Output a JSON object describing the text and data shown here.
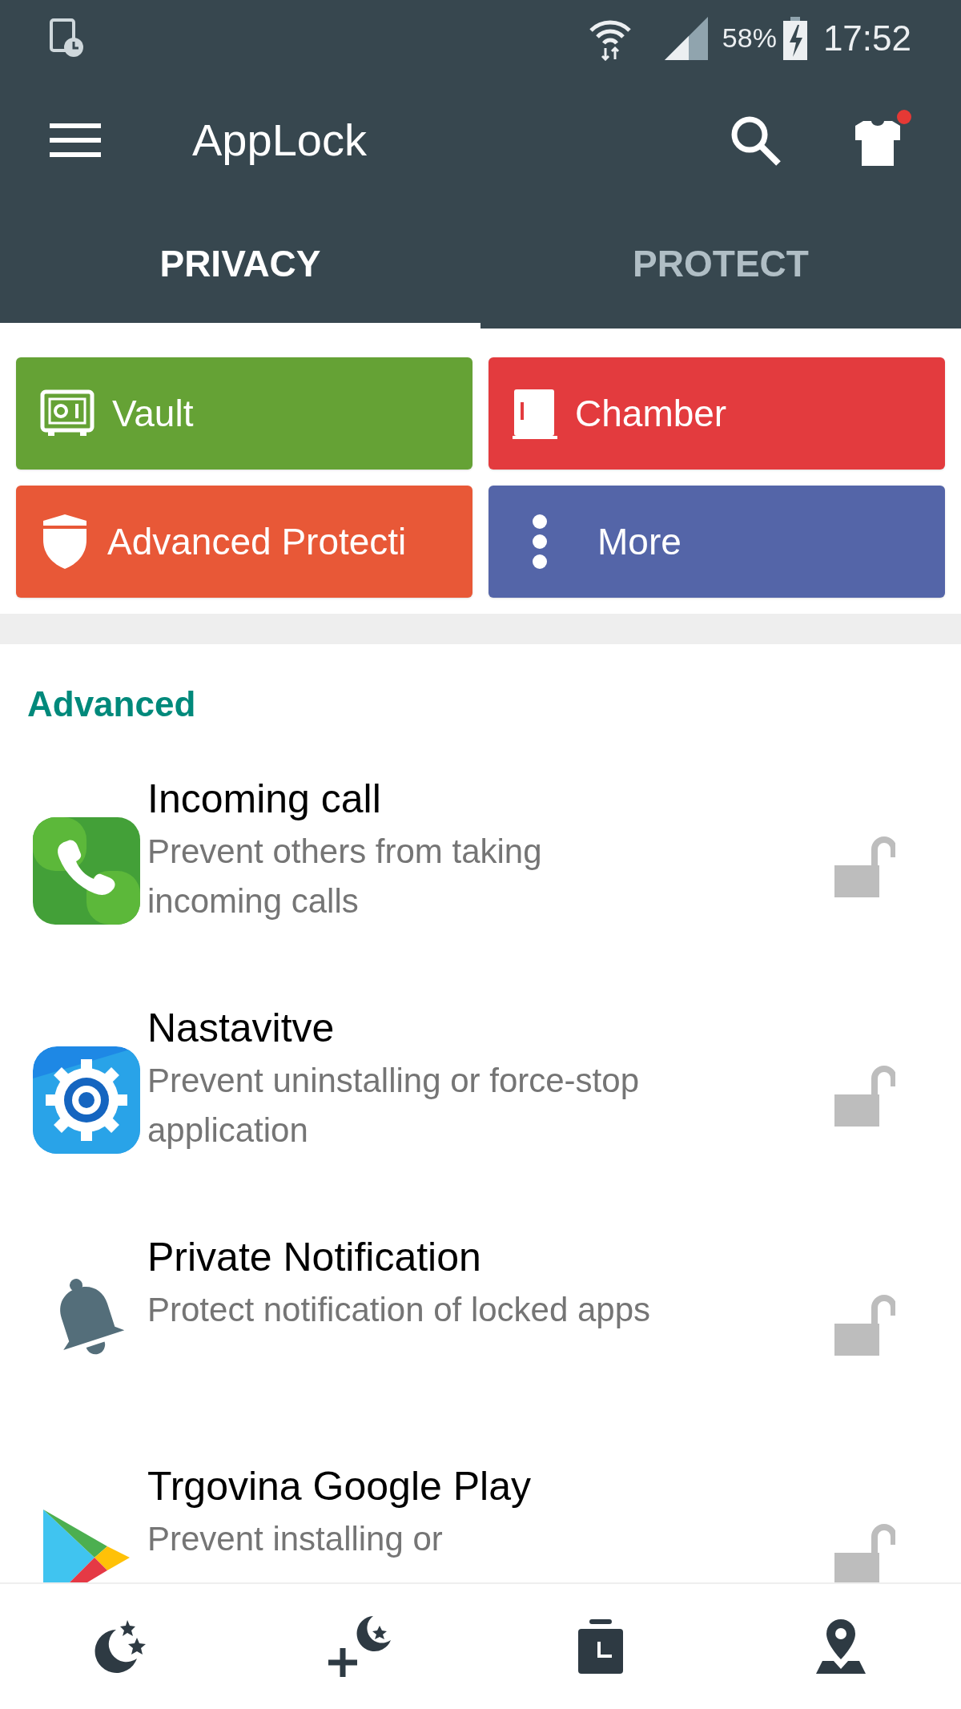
{
  "status_bar": {
    "battery": "58%",
    "time": "17:52"
  },
  "toolbar": {
    "title": "AppLock",
    "notification_dot": true
  },
  "tabs": [
    {
      "label": "PRIVACY",
      "selected": true
    },
    {
      "label": "PROTECT",
      "selected": false
    }
  ],
  "tiles": [
    {
      "kind": "vault",
      "label": "Vault",
      "color": "#65a235"
    },
    {
      "kind": "chamber",
      "label": "Chamber",
      "color": "#e33b3e"
    },
    {
      "kind": "shield",
      "label": "Advanced Protecti",
      "color": "#e85837"
    },
    {
      "kind": "more",
      "label": "More",
      "color": "#5465a8"
    }
  ],
  "section": {
    "title": "Advanced"
  },
  "items": [
    {
      "kind": "phone",
      "title": "Incoming call",
      "subtitle": "Prevent others from taking incoming calls",
      "locked": false
    },
    {
      "kind": "gear",
      "title": "Nastavitve",
      "subtitle": "Prevent uninstalling or force-stop application",
      "locked": false
    },
    {
      "kind": "bell",
      "title": "Private Notification",
      "subtitle": "Protect notification of locked apps",
      "locked": false
    },
    {
      "kind": "play",
      "title": "Trgovina Google Play",
      "subtitle": "Prevent installing or",
      "locked": false
    }
  ],
  "bottom_nav": [
    {
      "kind": "moon"
    },
    {
      "kind": "moon-plus"
    },
    {
      "kind": "clock"
    },
    {
      "kind": "pin"
    }
  ]
}
